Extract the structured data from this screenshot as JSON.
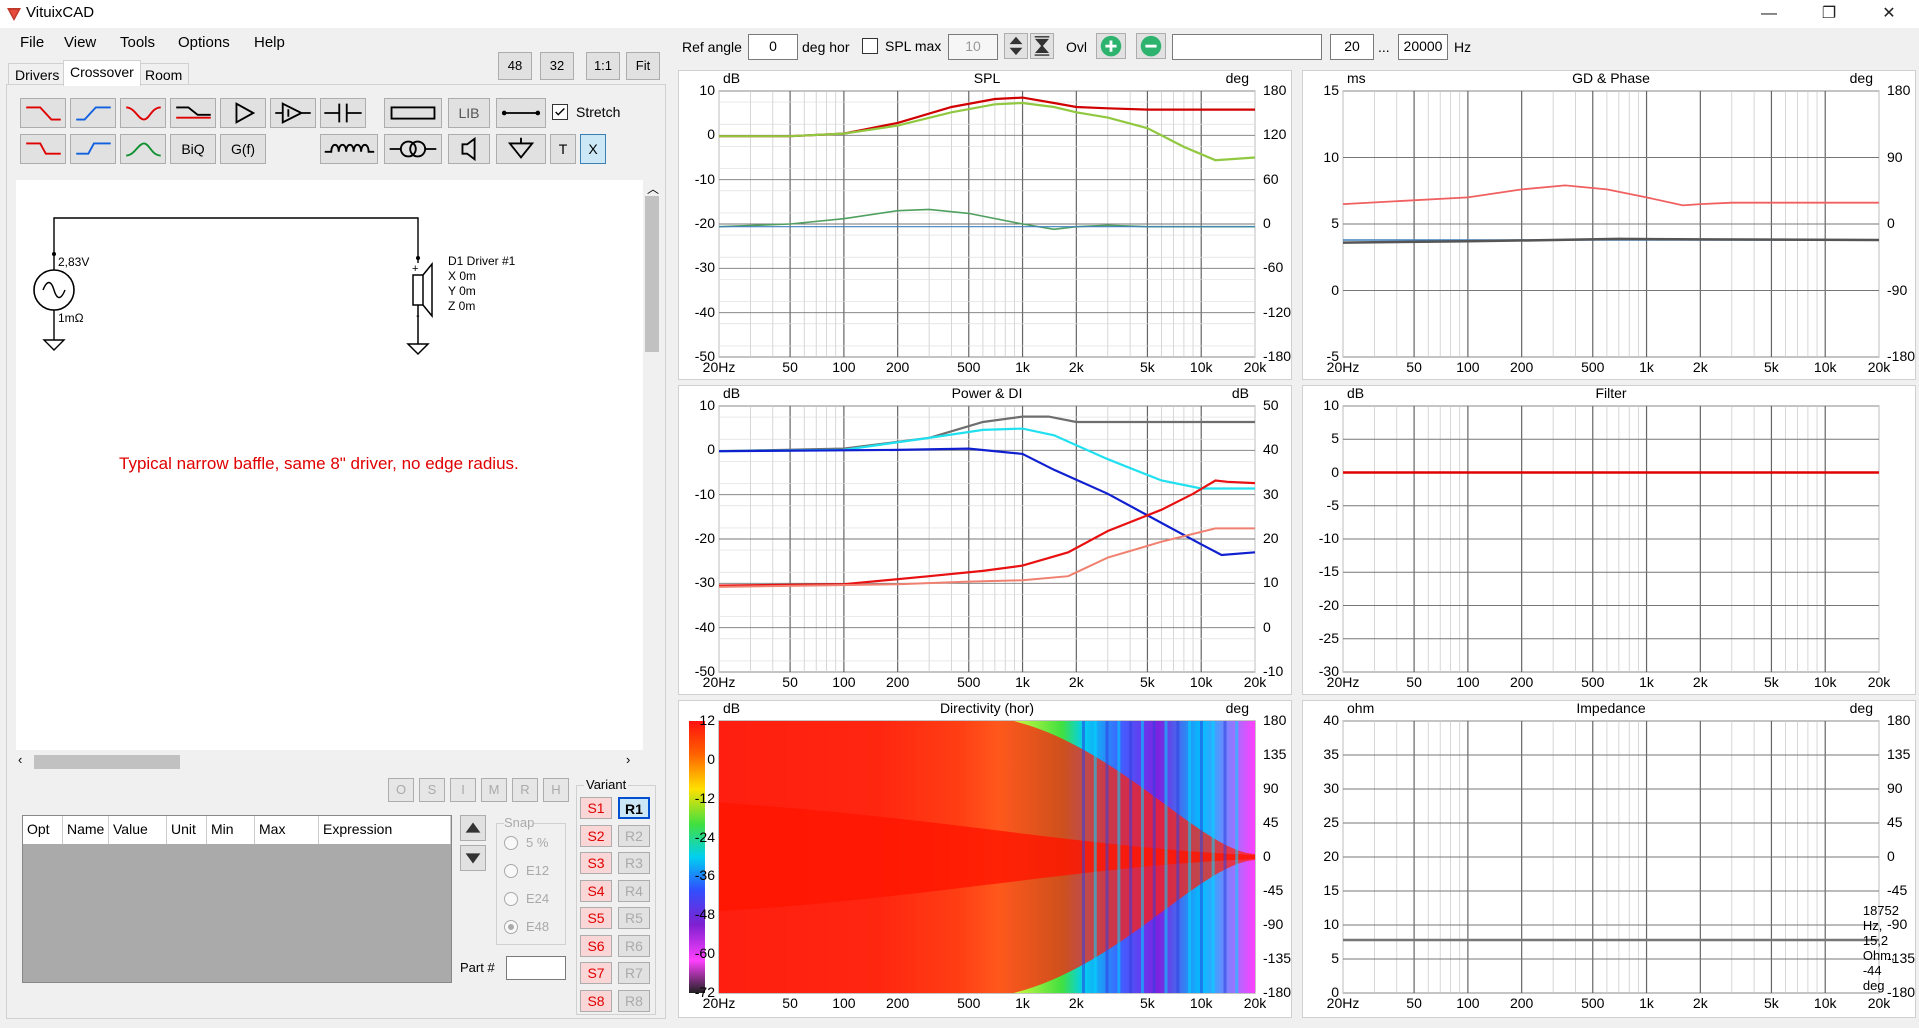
{
  "window": {
    "title": "VituixCAD",
    "controls": [
      "—",
      "❐",
      "✕"
    ]
  },
  "menu": [
    "File",
    "View",
    "Tools",
    "Options",
    "Help"
  ],
  "tabs": [
    "Drivers",
    "Crossover",
    "Room"
  ],
  "zoom_buttons": [
    "48",
    "32",
    "1:1",
    "Fit"
  ],
  "toolbar": {
    "lib": "LIB",
    "biq": "BiQ",
    "gf": "G(f)",
    "t": "T",
    "x": "X",
    "stretch_label": "Stretch",
    "stretch_checked": true
  },
  "schematic": {
    "source_voltage": "2,83V",
    "source_res": "1mΩ",
    "driver": {
      "name": "D1 Driver #1",
      "x": "X 0m",
      "y": "Y 0m",
      "z": "Z 0m"
    },
    "note": "Typical narrow baffle, same 8\" driver, no edge radius."
  },
  "part_buttons": [
    "O",
    "S",
    "I",
    "M",
    "R",
    "H"
  ],
  "param_columns": [
    "Opt",
    "Name",
    "Value",
    "Unit",
    "Min",
    "Max",
    "Expression"
  ],
  "snap": {
    "label": "Snap",
    "options": [
      "5 %",
      "E12",
      "E24",
      "E48"
    ],
    "selected": "E48"
  },
  "part_label": "Part #",
  "variant": {
    "label": "Variant",
    "s": [
      "S1",
      "S2",
      "S3",
      "S4",
      "S5",
      "S6",
      "S7",
      "S8"
    ],
    "r": [
      "R1",
      "R2",
      "R3",
      "R4",
      "R5",
      "R6",
      "R7",
      "R8"
    ],
    "active": "R1"
  },
  "controls": {
    "ref_angle_label": "Ref angle",
    "ref_angle": "0",
    "deg_hor": "deg hor",
    "spl_max_label": "SPL max",
    "spl_max": "10",
    "ovl": "Ovl",
    "f_min": "20",
    "dots": "...",
    "f_max": "20000",
    "hz": "Hz"
  },
  "graphs": {
    "spl": {
      "title": "SPL",
      "left_unit": "dB",
      "right_unit": "deg",
      "left_ticks": [
        "10",
        "0",
        "-10",
        "-20",
        "-30",
        "-40",
        "-50"
      ],
      "right_ticks": [
        "180",
        "120",
        "60",
        "0",
        "-60",
        "-120",
        "-180"
      ]
    },
    "gd": {
      "title": "GD & Phase",
      "left_unit": "ms",
      "right_unit": "deg",
      "left_ticks": [
        "15",
        "10",
        "5",
        "0",
        "-5"
      ],
      "right_ticks": [
        "180",
        "90",
        "0",
        "-90",
        "-180"
      ]
    },
    "power": {
      "title": "Power & DI",
      "left_unit": "dB",
      "right_unit": "dB",
      "left_ticks": [
        "10",
        "0",
        "-10",
        "-20",
        "-30",
        "-40",
        "-50"
      ],
      "right_ticks": [
        "50",
        "40",
        "30",
        "20",
        "10",
        "0",
        "-10"
      ]
    },
    "filter": {
      "title": "Filter",
      "left_unit": "dB",
      "left_ticks": [
        "10",
        "5",
        "0",
        "-5",
        "-10",
        "-15",
        "-20",
        "-25",
        "-30"
      ]
    },
    "directivity": {
      "title": "Directivity (hor)",
      "left_unit": "dB",
      "right_unit": "deg",
      "scale": [
        "12",
        "0",
        "-12",
        "-24",
        "-36",
        "-48",
        "-60",
        "-72"
      ],
      "right_ticks": [
        "180",
        "135",
        "90",
        "45",
        "0",
        "-45",
        "-90",
        "-135",
        "-180"
      ]
    },
    "impedance": {
      "title": "Impedance",
      "left_unit": "ohm",
      "right_unit": "deg",
      "left_ticks": [
        "40",
        "35",
        "30",
        "25",
        "20",
        "15",
        "10",
        "5",
        "0"
      ],
      "right_ticks": [
        "180",
        "135",
        "90",
        "45",
        "0",
        "-45",
        "-90",
        "-135",
        "-180"
      ],
      "readout": "18752 Hz, 15,2 Ohm, -44 deg"
    },
    "freq_ticks": [
      "20Hz",
      "50",
      "100",
      "200",
      "500",
      "1k",
      "2k",
      "5k",
      "10k",
      "20k"
    ]
  }
}
